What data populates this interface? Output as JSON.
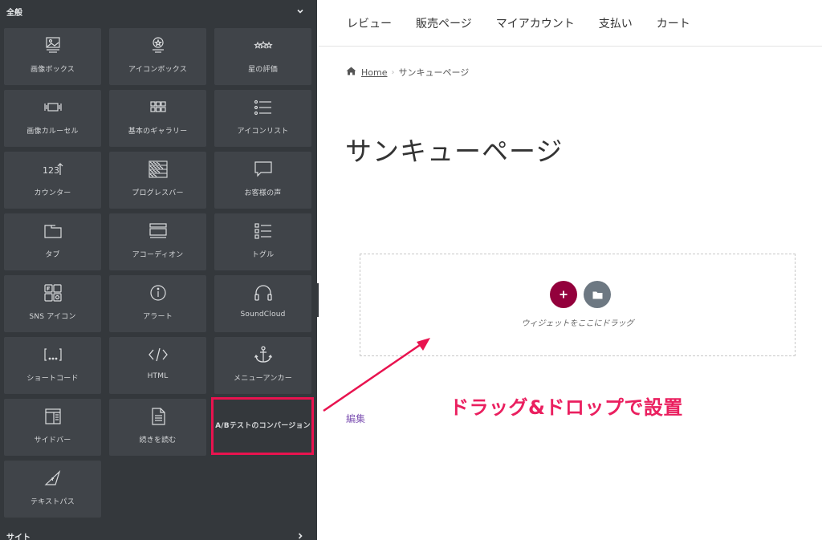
{
  "sidebar": {
    "section_top": "全般",
    "section_bottom": "サイト",
    "widgets": [
      {
        "label": "画像ボックス",
        "icon": "image-box-icon"
      },
      {
        "label": "アイコンボックス",
        "icon": "icon-box-icon"
      },
      {
        "label": "星の評価",
        "icon": "star-rating-icon"
      },
      {
        "label": "画像カルーセル",
        "icon": "image-carousel-icon"
      },
      {
        "label": "基本のギャラリー",
        "icon": "gallery-icon"
      },
      {
        "label": "アイコンリスト",
        "icon": "icon-list-icon"
      },
      {
        "label": "カウンター",
        "icon": "counter-icon"
      },
      {
        "label": "プログレスバー",
        "icon": "progress-bar-icon"
      },
      {
        "label": "お客様の声",
        "icon": "testimonial-icon"
      },
      {
        "label": "タブ",
        "icon": "tabs-icon"
      },
      {
        "label": "アコーディオン",
        "icon": "accordion-icon"
      },
      {
        "label": "トグル",
        "icon": "toggle-icon"
      },
      {
        "label": "SNS アイコン",
        "icon": "social-icons-icon"
      },
      {
        "label": "アラート",
        "icon": "alert-icon"
      },
      {
        "label": "SoundCloud",
        "icon": "soundcloud-icon"
      },
      {
        "label": "ショートコード",
        "icon": "shortcode-icon"
      },
      {
        "label": "HTML",
        "icon": "html-icon"
      },
      {
        "label": "メニューアンカー",
        "icon": "anchor-icon"
      },
      {
        "label": "サイドバー",
        "icon": "sidebar-icon"
      },
      {
        "label": "続きを読む",
        "icon": "read-more-icon"
      },
      {
        "label": "A/Bテストのコンバージョン",
        "icon": ""
      },
      {
        "label": "テキストパス",
        "icon": "text-path-icon"
      }
    ]
  },
  "nav": {
    "items": [
      "レビュー",
      "販売ページ",
      "マイアカウント",
      "支払い",
      "カート"
    ]
  },
  "breadcrumb": {
    "home": "Home",
    "current": "サンキューページ"
  },
  "page": {
    "title": "サンキューページ",
    "drop_text": "ウィジェットをここにドラッグ",
    "edit_link": "編集"
  },
  "annotation": {
    "text": "ドラッグ&ドロップで設置",
    "color": "#ea1f5f"
  },
  "colors": {
    "sidebar_bg": "#34383c",
    "tile_bg": "#404449",
    "add_button": "#93003c",
    "template_button": "#6d7882",
    "highlight": "#e8134f"
  }
}
